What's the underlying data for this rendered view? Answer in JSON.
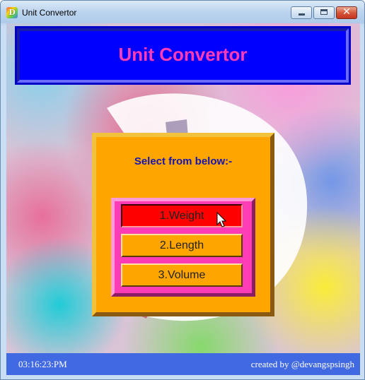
{
  "window": {
    "title": "Unit Convertor",
    "icon": "app-logo-icon",
    "controls": {
      "minimize": "minimize-icon",
      "maximize": "maximize-icon",
      "close": "close-icon"
    }
  },
  "header": {
    "title": "Unit Convertor"
  },
  "menu": {
    "heading": "Select from below:-",
    "options": [
      {
        "label": "1.Weight",
        "state": "hover"
      },
      {
        "label": "2.Length",
        "state": "normal"
      },
      {
        "label": "3.Volume",
        "state": "normal"
      }
    ]
  },
  "status_bar": {
    "clock": "03:16:23:PM",
    "credit": "created by @devangspsingh"
  },
  "colors": {
    "header_bg": "#0000ff",
    "header_text": "#ff3bb5",
    "menu_bg": "#ffa500",
    "heading_text": "#1515b0",
    "button_group_bg": "#ff3bb5",
    "active_button": "#ff0000",
    "status_bar_bg": "#4169e1"
  }
}
